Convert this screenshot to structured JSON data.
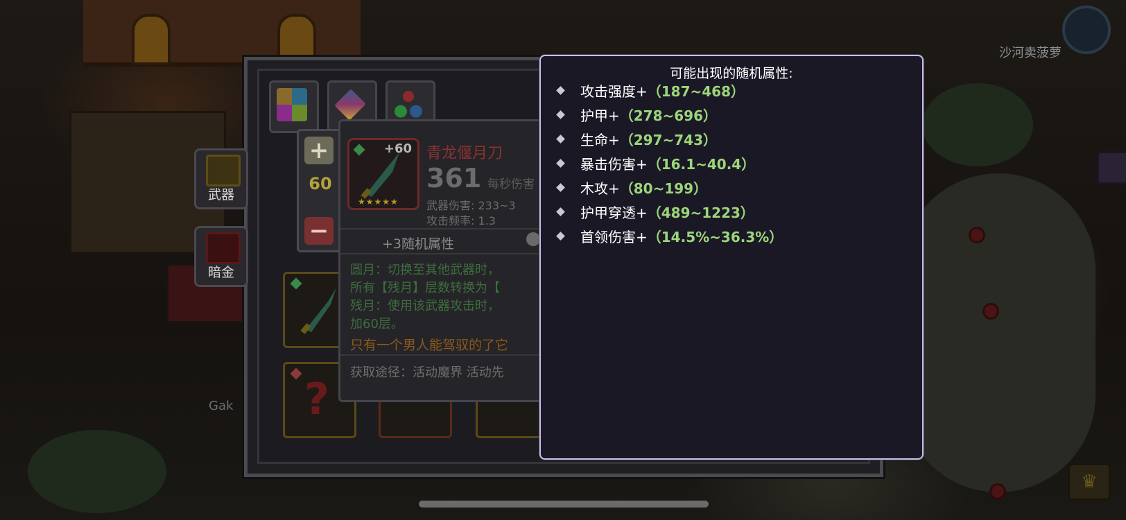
{
  "player_name": "沙河卖菠萝",
  "npc_name": "Gak",
  "side_tabs": [
    {
      "label": "武器",
      "icon": "sword-slot-icon"
    },
    {
      "label": "暗金",
      "icon": "chest-slot-icon"
    }
  ],
  "stepper": {
    "plus": "+",
    "value": "60",
    "minus": "−"
  },
  "item": {
    "level_plus": "+60",
    "stars": "★★★★★",
    "name": "青龙偃月刀",
    "power": "361",
    "dps_label": "每秒伤害",
    "damage_label": "武器伤害: 233~3",
    "speed_label": "攻击频率: 1.3",
    "random_attr_label": "+3随机属性",
    "effect_text": "圆月：切换至其他武器时，\n所有【残月】层数转换为【\n残月：使用该武器攻击时，\n加60层。",
    "quote": "只有一个男人能驾驭的了它",
    "source": "获取途径：活动魔界  活动先"
  },
  "tooltip": {
    "title": "可能出现的随机属性:",
    "attributes": [
      {
        "name": "攻击强度+",
        "range": "（187~468）"
      },
      {
        "name": "护甲+",
        "range": "（278~696）"
      },
      {
        "name": "生命+",
        "range": "（297~743）"
      },
      {
        "name": "暴击伤害+",
        "range": "（16.1~40.4）"
      },
      {
        "name": "木攻+",
        "range": "（80~199）"
      },
      {
        "name": "护甲穿透+",
        "range": "（489~1223）"
      },
      {
        "name": "首领伤害+",
        "range": "（14.5%~36.3%）"
      }
    ]
  },
  "colors": {
    "attr_value": "#9cd67a",
    "tooltip_border": "#c9bfe6",
    "item_name": "#8a3232",
    "effect_text": "#3d6e3d"
  }
}
